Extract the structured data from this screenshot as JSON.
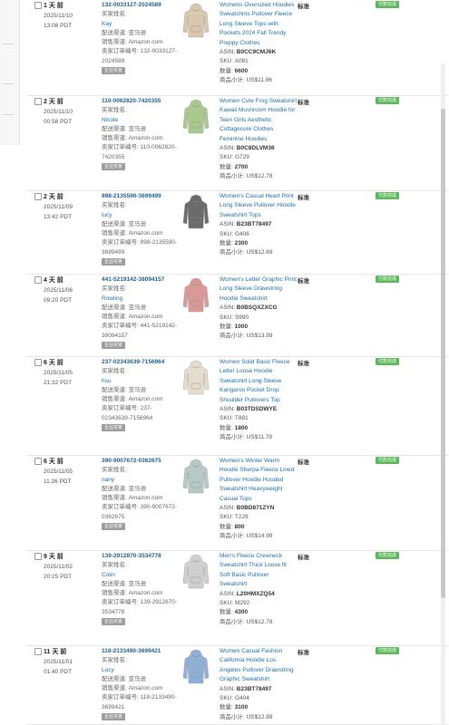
{
  "ui": {
    "status_color": "#5cb85c",
    "link_color": "#1f6fa8"
  },
  "orders": [
    {
      "age": "1 天 前",
      "date": "2025/11/10",
      "time": "13:08 PDT",
      "order_id": "132-0033127-2024589",
      "buyer_label": "买家姓名:",
      "buyer": "Kay",
      "channel": "配送渠道: 亚马逊",
      "sales_channel": "销售渠道: Amazon.com",
      "seller_order_label": "卖家订单编号: 132-0033127-",
      "seller_order_tail": "2024589",
      "badge": "企业买家",
      "title_lines": [
        "Womens Oversized Hoodies",
        "Sweatshirts Pullover Fleece",
        "Long Sleeve Tops with",
        "Pockets 2024 Fall Trendy",
        "Preppy Clothes"
      ],
      "asin_label": "ASIN: ",
      "asin": "B0CC9CMJ6K",
      "sku": "SKU: A081",
      "qty_label": "数量: ",
      "qty": "6600",
      "subtotal": "商品小计: US$11.96",
      "shipping": "标准",
      "status": "付款完成",
      "item_color": "#d9c7ae",
      "item_icon": "hoodie-beige-icon"
    },
    {
      "age": "2 天 前",
      "date": "2025/11/10",
      "time": "00:58 PDT",
      "order_id": "110-0062820-7420355",
      "buyer_label": "买家姓名:",
      "buyer": "Nicole",
      "channel": "配送渠道: 亚马逊",
      "sales_channel": "销售渠道: Amazon.com",
      "seller_order_label": "卖家订单编号: 110-0062820-",
      "seller_order_tail": "7420355",
      "badge": "企业买家",
      "title_lines": [
        "Women Cute Frog Sweatshirt",
        "Kawaii Mushroom Hoodie for",
        "Teen Girls Aesthetic",
        "Cottagecore Clothes",
        "Feminine Hoodies"
      ],
      "asin_label": "ASIN: ",
      "asin": "B0C8DLVM36",
      "sku": "SKU: G729",
      "qty_label": "数量: ",
      "qty": "2700",
      "subtotal": "商品小计: US$12.78",
      "shipping": "标准",
      "status": "付款完成",
      "item_color": "#a9c98f",
      "item_icon": "hoodie-green-icon"
    },
    {
      "age": "2 天 前",
      "date": "2025/11/09",
      "time": "13:42 PDT",
      "order_id": "898-2135590-3699499",
      "buyer_label": "买家姓名:",
      "buyer": "lucy",
      "channel": "配送渠道: 亚马逊",
      "sales_channel": "销售渠道: Amazon.com",
      "seller_order_label": "卖家订单编号: 898-2135590-",
      "seller_order_tail": "3699499",
      "badge": "企业买家",
      "title_lines": [
        "Women's Casual Heart Print",
        "Long Sleeve Pullover Hoodie",
        "Sweatshirt Tops"
      ],
      "asin_label": "ASIN: ",
      "asin": "B23BT78497",
      "sku": "SKU: G406",
      "qty_label": "数量: ",
      "qty": "2300",
      "subtotal": "商品小计: US$12.69",
      "shipping": "标准",
      "status": "付款完成",
      "item_color": "#6b6b6b",
      "item_icon": "hoodie-grey-icon"
    },
    {
      "age": "4 天 前",
      "date": "2025/11/06",
      "time": "09:20 PDT",
      "order_id": "441-5219142-38094157",
      "buyer_label": "买家姓名:",
      "buyer": "Rowling",
      "channel": "配送渠道: 亚马逊",
      "sales_channel": "销售渠道: Amazon.com",
      "seller_order_label": "卖家订单编号: 441-5219142-",
      "seller_order_tail": "38094157",
      "badge": "企业买家",
      "title_lines": [
        "Women's Letter Graphic Print",
        "Long Sleeve Drawstring",
        "Hoodie Sweatshirt"
      ],
      "asin_label": "ASIN: ",
      "asin": "B0BSQXZXCG",
      "sku": "SKU: S990",
      "qty_label": "数量: ",
      "qty": "1000",
      "subtotal": "商品小计: US$13.99",
      "shipping": "标准",
      "status": "付款完成",
      "item_color": "#d99a96",
      "item_icon": "hoodie-pink-icon"
    },
    {
      "age": "6 天 前",
      "date": "2025/11/05",
      "time": "21:32 PDT",
      "order_id": "237-02343639-7156964",
      "buyer_label": "买家姓名:",
      "buyer": "hsu",
      "channel": "配送渠道: 亚马逊",
      "sales_channel": "销售渠道: Amazon.com",
      "seller_order_label": "卖家订单编号: 237-",
      "seller_order_tail": "02343639-7156964",
      "badge": "企业买家",
      "title_lines": [
        "Women Solid Basic Fleece",
        "Letter Loose Hoodie",
        "Sweatshirt Long Sleeve",
        "Kangaroo Pocket Drop",
        "Shoulder Pullovers Top"
      ],
      "asin_label": "ASIN: ",
      "asin": "B03TDSDWYE",
      "sku": "SKU: T881",
      "qty_label": "数量: ",
      "qty": "1800",
      "subtotal": "商品小计: US$11.79",
      "shipping": "标准",
      "status": "付款完成",
      "item_color": "#e6dccd",
      "item_icon": "hoodie-cream-icon"
    },
    {
      "age": "6 天 前",
      "date": "2025/11/05",
      "time": "11:26 PDT",
      "order_id": "390-9007672-0362675",
      "buyer_label": "买家姓名:",
      "buyer": "nany",
      "channel": "配送渠道: 亚马逊",
      "sales_channel": "销售渠道: Amazon.com",
      "seller_order_label": "卖家订单编号: 390-9007672-",
      "seller_order_tail": "0362675",
      "badge": "企业买家",
      "title_lines": [
        "Women's Winter Warm",
        "Hoodie Sherpa Fleece Lined",
        "Pullover Hoodie Hooded",
        "Sweatshirt Heavyweight",
        "Casual Tops"
      ],
      "asin_label": "ASIN: ",
      "asin": "B0BD871ZYN",
      "sku": "SKU: T229",
      "qty_label": "数量: ",
      "qty": "800",
      "subtotal": "商品小计: US$14.99",
      "shipping": "标准",
      "status": "付款完成",
      "item_color": "#b7c9c4",
      "item_icon": "hoodie-sage-icon"
    },
    {
      "age": "9 天 前",
      "date": "2025/11/02",
      "time": "20:25 PDT",
      "order_id": "139-2912870-3534778",
      "buyer_label": "买家姓名:",
      "buyer": "Colin",
      "channel": "配送渠道: 亚马逊",
      "sales_channel": "销售渠道: Amazon.com",
      "seller_order_label": "卖家订单编号: 139-2912870-",
      "seller_order_tail": "3534778",
      "badge": "企业买家",
      "title_lines": [
        "Men's Fleece Crewneck",
        "Sweatshirt Thick Loose fit",
        "Soft Basic Pullover",
        "Sweatshirt"
      ],
      "asin_label": "ASIN: ",
      "asin": "L20HMXZQ54",
      "sku": "SKU: M292",
      "qty_label": "数量: ",
      "qty": "4300",
      "subtotal": "商品小计: US$12.78",
      "shipping": "标准",
      "status": "付款完成",
      "item_color": "#cfcfcf",
      "item_icon": "sweatshirt-grey-icon"
    },
    {
      "age": "11 天 前",
      "date": "2025/11/01",
      "time": "01:40 PDT",
      "order_id": "118-2133490-3699421",
      "buyer_label": "买家姓名:",
      "buyer": "Lucy",
      "channel": "配送渠道: 亚马逊",
      "sales_channel": "销售渠道: Amazon.com",
      "seller_order_label": "卖家订单编号: 118-2133490-",
      "seller_order_tail": "3699421",
      "badge": "企业买家",
      "title_lines": [
        "Women Casual Fashion",
        "California Hoodie Los",
        "Angeles Pullover Drawstring",
        "Graphic Sweatshirt"
      ],
      "asin_label": "ASIN: ",
      "asin": "B23BT78497",
      "sku": "SKU: G404",
      "qty_label": "数量: ",
      "qty": "3100",
      "subtotal": "商品小计: US$12.89",
      "shipping": "标准",
      "status": "付款完成",
      "item_color": "#8fb0d6",
      "item_icon": "hoodie-blue-icon"
    }
  ]
}
